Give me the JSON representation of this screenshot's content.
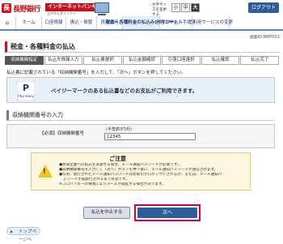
{
  "header": {
    "logo_mark": "長",
    "bank_name": "長野銀行",
    "service_badge": "インターネットバンキング",
    "service_sub": "ながぎんダイレクト",
    "fontsize_label": "文字サイズを変更する",
    "fontsize_small": "小",
    "fontsize_mid": "中",
    "fontsize_large": "大",
    "logout_label": "ログアウト"
  },
  "nav": [
    {
      "label": "ホーム",
      "active": false
    },
    {
      "label": "口座情報",
      "active": false
    },
    {
      "label": "振込・振替",
      "active": false
    },
    {
      "label": "資産運用",
      "active": false
    },
    {
      "label": "税金・各種料金の払込み(ペイジー)",
      "active": true
    },
    {
      "label": "各種お申込み手続き",
      "active": false
    },
    {
      "label": "ご利用サービスの変更",
      "active": false
    }
  ],
  "screen_id": "画面ID:BMP001",
  "page_title": "税金・各種料金の払込",
  "steps": [
    {
      "label": "収納機関指定",
      "current": true
    },
    {
      "label": "払込先情報入力",
      "current": false
    },
    {
      "label": "払込書選択",
      "current": false
    },
    {
      "label": "払込金額確認",
      "current": false
    },
    {
      "label": "払込金額確認",
      "current": false
    },
    {
      "label": "引落口座選択",
      "current": false
    },
    {
      "label": "払込確認",
      "current": false
    },
    {
      "label": "払込完了",
      "current": false
    }
  ],
  "instruction": "払込書に記載されている「収納機関番号」を入力して、「次へ」ボタンを押してください。",
  "payeasy": {
    "logo_text": "Pay-easy",
    "message": "ペイジーマークのある払込書などのお支払がご利用できます。"
  },
  "section": {
    "title": "収納機関番号の入力",
    "field_label": "【必須】収納機関番号",
    "field_hint": "(半角数字5桁)",
    "field_value": "12345"
  },
  "caution": {
    "title": "ご注意",
    "lines": [
      "●民間企業への払込を実施する場合、メール通知パスワードが必要です。",
      "●収納機関番号を入力して「次へ」ボタンを押下後に、メール通知パスワードが送信されます。",
      "●なお、発行されたメール通知パスワードはお取引がログアウトされるか、または、メール通知パ",
      "　スワードが再発行されるまで有効です。",
      "※プロバイダーの事情によりメールが遅延する場合があります。"
    ]
  },
  "buttons": {
    "cancel": "払込を中止する",
    "next": "次へ"
  },
  "top_link": "トップページへ",
  "colors": {
    "brand_red": "#c8101a",
    "nav_blue": "#2e5e99",
    "highlight_frame": "#e3003a"
  }
}
